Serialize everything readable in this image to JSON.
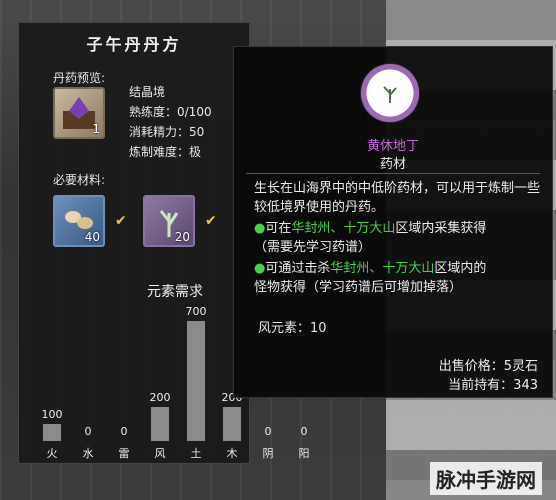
{
  "panel": {
    "title": "子午丹丹方",
    "preview_label": "丹药预览:",
    "output_item": {
      "icon": "crystal-box-icon",
      "count": "1"
    },
    "stats": [
      "结晶境",
      "熟练度：0/100",
      "消耗精力：50",
      "炼制难度：极"
    ],
    "materials_label": "必要材料:",
    "materials": [
      {
        "icon": "seed-icon",
        "count": "40"
      },
      {
        "icon": "herb-icon",
        "count": "20"
      }
    ],
    "elements_title": "元素需求"
  },
  "chart_data": {
    "type": "bar",
    "title": "元素需求",
    "categories": [
      "火",
      "水",
      "雷",
      "风",
      "土",
      "木",
      "阴",
      "阳"
    ],
    "values": [
      100,
      0,
      0,
      200,
      700,
      200,
      0,
      0
    ],
    "ylim": [
      0,
      700
    ]
  },
  "tooltip": {
    "name": "黄休地丁",
    "type": "药材",
    "desc": "生长在山海界中的中低阶药材，可以用于炼制一些较低境界使用的丹药。",
    "line1_prefix": "可在",
    "line1_place": "华封州、十万大山",
    "line1_suffix": "区域内采集获得",
    "line1_note": "（需要先学习药谱）",
    "line2_prefix": "可通过击杀",
    "line2_place": "华封州、十万大山",
    "line2_suffix": "区域内的",
    "line2_note": "怪物获得（学习药谱后可增加掉落）",
    "wind": "风元素：10",
    "price": "出售价格：5灵石",
    "hold": "当前持有：343",
    "name_color": "#c46ad6",
    "accent_color": "#44d34a"
  },
  "watermark": "脉冲手游网"
}
